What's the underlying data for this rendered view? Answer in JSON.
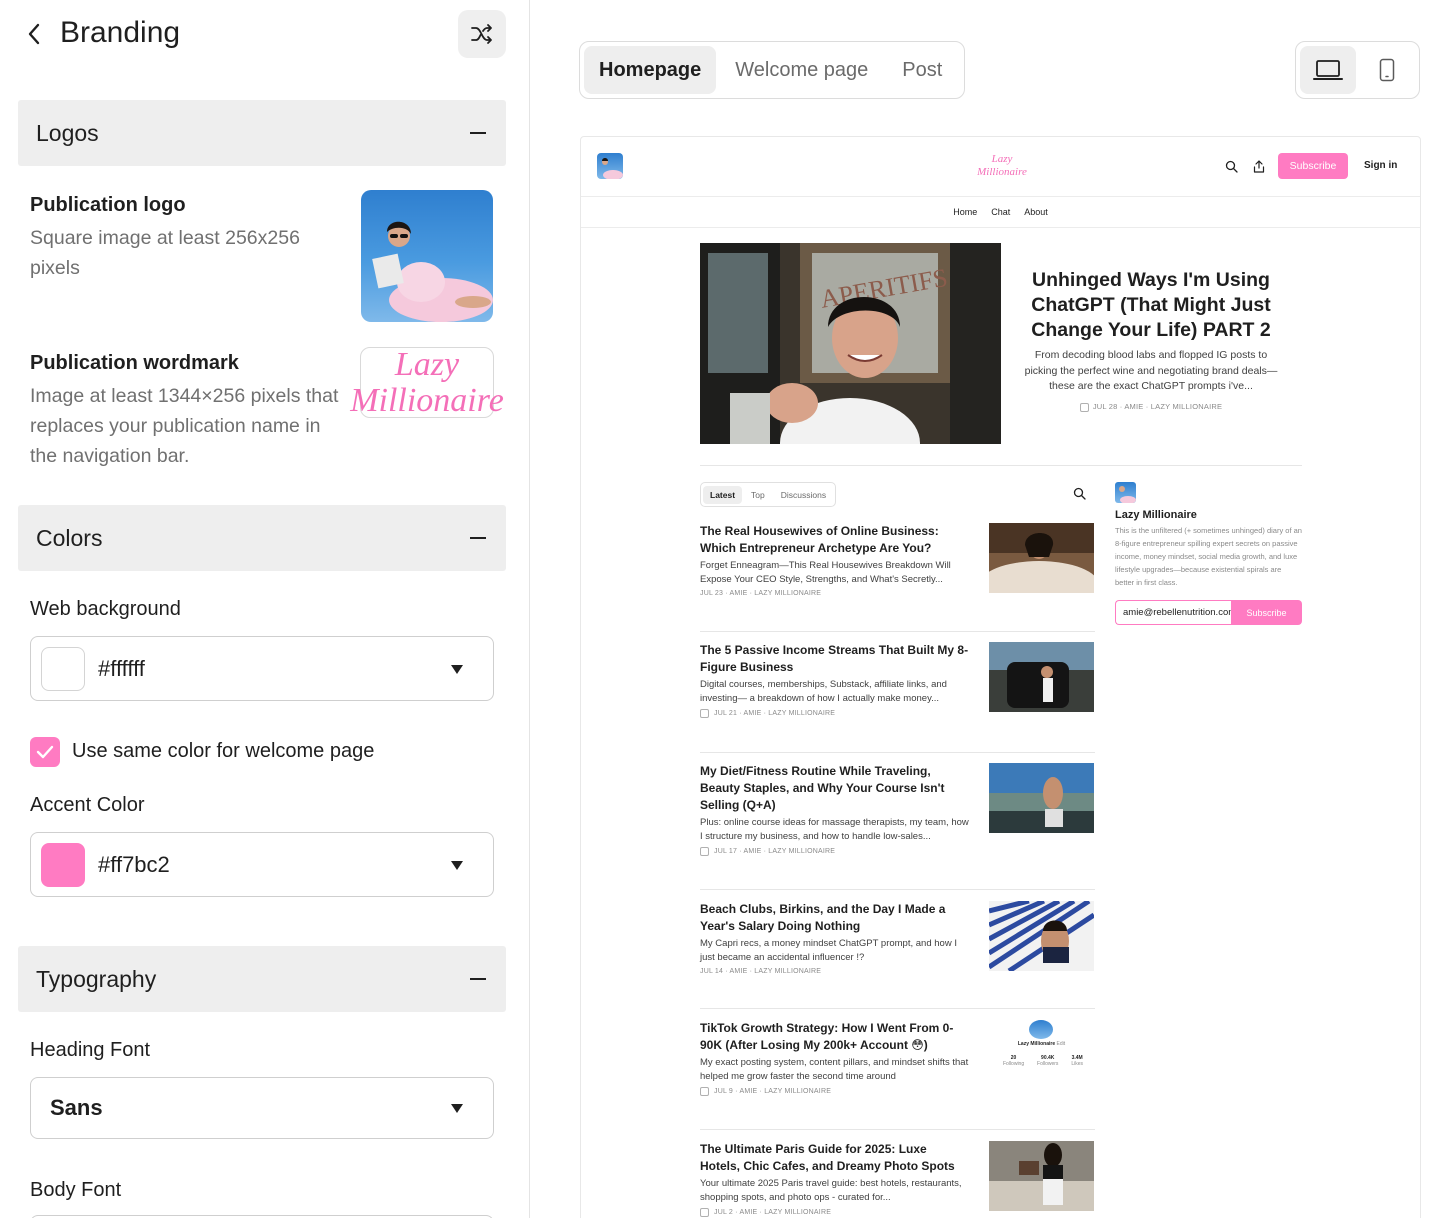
{
  "header": {
    "title": "Branding"
  },
  "sections": {
    "logos": "Logos",
    "colors": "Colors",
    "typography": "Typography"
  },
  "logos": {
    "publication_logo": {
      "title": "Publication logo",
      "desc": "Square image at least 256x256 pixels"
    },
    "publication_wordmark": {
      "title": "Publication wordmark",
      "desc": "Image at least 1344×256 pixels that replaces your publication name in the navigation bar."
    },
    "wordmark_text": [
      "Lazy",
      "Millionaire"
    ]
  },
  "colors": {
    "web_background": {
      "label": "Web background",
      "value": "#ffffff"
    },
    "same_color_checkbox": {
      "label": "Use same color for welcome page",
      "checked": true
    },
    "accent": {
      "label": "Accent Color",
      "value": "#ff7bc2"
    }
  },
  "typography": {
    "heading_font": {
      "label": "Heading Font",
      "value": "Sans"
    },
    "body_font": {
      "label": "Body Font"
    }
  },
  "preview_tabs": [
    "Homepage",
    "Welcome page",
    "Post"
  ],
  "active_preview_tab": "Homepage",
  "devices": [
    "laptop-icon",
    "phone-icon"
  ],
  "preview": {
    "wordmark": [
      "Lazy",
      "Millionaire"
    ],
    "subscribe_label": "Subscribe",
    "signin_label": "Sign in",
    "nav": [
      "Home",
      "Chat",
      "About"
    ],
    "hero": {
      "title": "Unhinged Ways I'm Using ChatGPT (That Might Just Change Your Life) PART 2",
      "desc": "From decoding blood labs and flopped IG posts to picking the perfect wine and negotiating brand deals—these are the exact ChatGPT prompts i've...",
      "meta": "JUL 28 · AMIE · LAZY MILLIONAIRE"
    },
    "feed_tabs": [
      "Latest",
      "Top",
      "Discussions"
    ],
    "posts": [
      {
        "title": "The Real Housewives of Online Business: Which Entrepreneur Archetype Are You?",
        "desc": "Forget Enneagram—This Real Housewives Breakdown Will Expose Your CEO Style, Strengths, and What's Secretly...",
        "meta": "JUL 23 · AMIE · LAZY MILLIONAIRE",
        "locked": false
      },
      {
        "title": "The 5 Passive Income Streams That Built My 8-Figure Business",
        "desc": "Digital courses, memberships, Substack, affiliate links, and investing— a breakdown of how I actually make money...",
        "meta": "JUL 21 · AMIE · LAZY MILLIONAIRE",
        "locked": true
      },
      {
        "title": "My Diet/Fitness Routine While Traveling, Beauty Staples, and Why Your Course Isn't Selling (Q+A)",
        "desc": "Plus: online course ideas for massage therapists, my team, how I structure my business, and how to handle low-sales...",
        "meta": "JUL 17 · AMIE · LAZY MILLIONAIRE",
        "locked": true
      },
      {
        "title": "Beach Clubs, Birkins, and the Day I Made a Year's Salary Doing Nothing",
        "desc": "My Capri recs, a money mindset ChatGPT prompt, and how I just became an accidental influencer !?",
        "meta": "JUL 14 · AMIE · LAZY MILLIONAIRE",
        "locked": false
      },
      {
        "title": "TikTok Growth Strategy: How I Went From 0-90K (After Losing My 200k+ Account 😳)",
        "desc": "My exact posting system, content pillars, and mindset shifts that helped me grow faster the second time around",
        "meta": "JUL 9 · AMIE · LAZY MILLIONAIRE",
        "locked": true
      },
      {
        "title": "The Ultimate Paris Guide for 2025: Luxe Hotels, Chic Cafes, and Dreamy Photo Spots",
        "desc": "Your ultimate 2025 Paris travel guide: best hotels, restaurants, shopping spots, and photo ops - curated for...",
        "meta": "JUL 2 · AMIE · LAZY MILLIONAIRE",
        "locked": true
      }
    ],
    "tiktok_thumb": {
      "name": "Lazy Millionaire",
      "follow": "Edit",
      "stats": [
        {
          "value": "20",
          "label": "Following"
        },
        {
          "value": "90.4K",
          "label": "Followers"
        },
        {
          "value": "3.4M",
          "label": "Likes"
        }
      ]
    },
    "sidebar": {
      "name": "Lazy Millionaire",
      "desc": "This is the unfiltered (+ sometimes unhinged) diary of an 8-figure entrepreneur spilling expert secrets on passive income, money mindset, social media growth, and luxe lifestyle upgrades—because existential spirals are better in first class.",
      "email": "amie@rebellenutrition.com",
      "subscribe": "Subscribe"
    }
  }
}
